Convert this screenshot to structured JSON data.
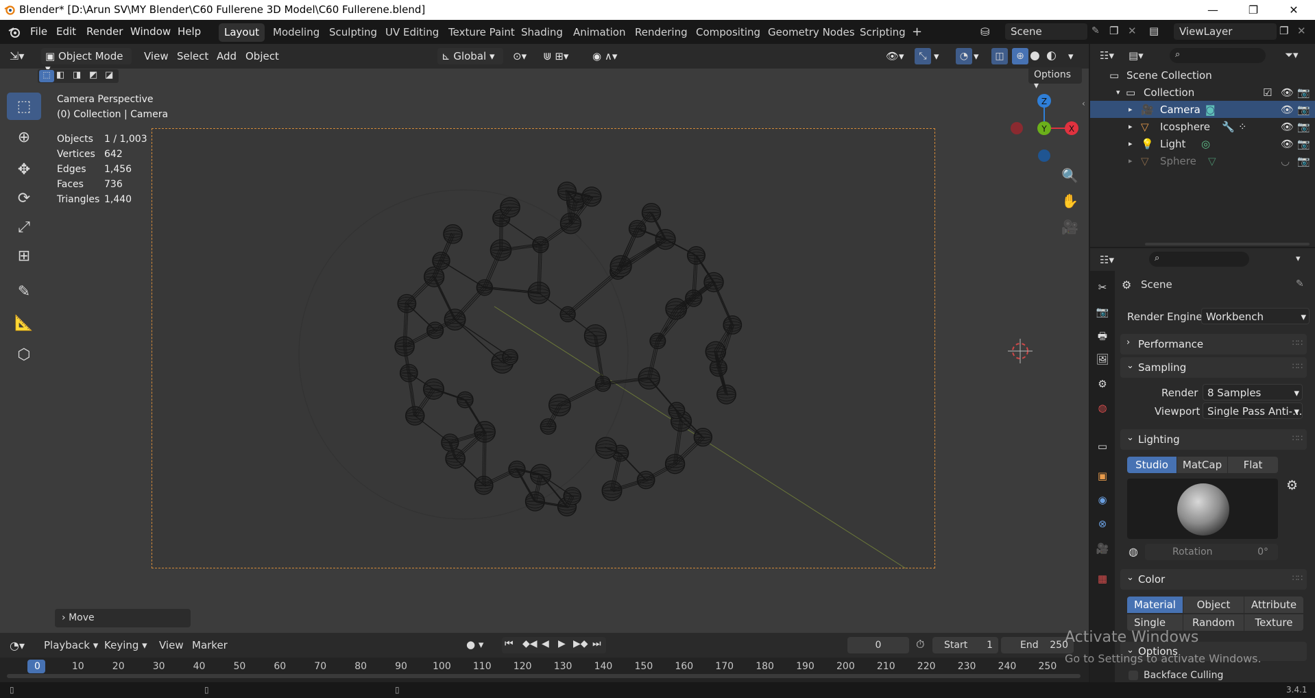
{
  "window": {
    "title": "Blender* [D:\\Arun SV\\MY Blender\\C60 Fullerene 3D Model\\C60 Fullerene.blend]",
    "minimize": "—",
    "maximize": "❐",
    "close": "✕"
  },
  "menu": {
    "items": [
      "File",
      "Edit",
      "Render",
      "Window",
      "Help"
    ]
  },
  "workspaces": {
    "tabs": [
      "Layout",
      "Modeling",
      "Sculpting",
      "UV Editing",
      "Texture Paint",
      "Shading",
      "Animation",
      "Rendering",
      "Compositing",
      "Geometry Nodes",
      "Scripting"
    ],
    "active": "Layout",
    "add": "+"
  },
  "scene": {
    "label": "Scene",
    "view_layer": "ViewLayer"
  },
  "viewport": {
    "mode": "Object Mode",
    "menus": [
      "View",
      "Select",
      "Add",
      "Object"
    ],
    "transform_orientation": "Global",
    "options_label": "Options",
    "camera_title": "Camera Perspective",
    "collection_path": "(0) Collection | Camera",
    "stats": [
      {
        "key": "Objects",
        "value": "1 / 1,003"
      },
      {
        "key": "Vertices",
        "value": "642"
      },
      {
        "key": "Edges",
        "value": "1,456"
      },
      {
        "key": "Faces",
        "value": "736"
      },
      {
        "key": "Triangles",
        "value": "1,440"
      }
    ],
    "last_operator": "Move",
    "gizmo": {
      "z": "Z",
      "y": "Y",
      "x": "X"
    }
  },
  "outliner": {
    "root": "Scene Collection",
    "collection": "Collection",
    "items": [
      {
        "name": "Camera",
        "selected": true,
        "dimmed": false
      },
      {
        "name": "Icosphere",
        "selected": false,
        "dimmed": false
      },
      {
        "name": "Light",
        "selected": false,
        "dimmed": false
      },
      {
        "name": "Sphere",
        "selected": false,
        "dimmed": true
      }
    ]
  },
  "properties": {
    "context": "Scene",
    "render_engine_label": "Render Engine",
    "render_engine": "Workbench",
    "panels": {
      "performance": "Performance",
      "sampling": "Sampling",
      "lighting": "Lighting",
      "color": "Color",
      "options": "Options"
    },
    "sampling": {
      "render_label": "Render",
      "render_value": "8 Samples",
      "viewport_label": "Viewport",
      "viewport_value": "Single Pass Anti-..."
    },
    "lighting": {
      "modes": [
        "Studio",
        "MatCap",
        "Flat"
      ],
      "active": "Studio",
      "rotation_label": "Rotation",
      "rotation_value": "0°"
    },
    "color": {
      "row1": [
        "Material",
        "Object",
        "Attribute"
      ],
      "row2": [
        "Single",
        "Random",
        "Texture"
      ],
      "active": "Material"
    },
    "backface_culling": "Backface Culling"
  },
  "timeline": {
    "menus": [
      "Playback",
      "Keying",
      "View",
      "Marker"
    ],
    "current_frame": "0",
    "start_label": "Start",
    "start": "1",
    "end_label": "End",
    "end": "250",
    "ticks": [
      "0",
      "10",
      "20",
      "30",
      "40",
      "50",
      "60",
      "70",
      "80",
      "90",
      "100",
      "110",
      "120",
      "130",
      "140",
      "150",
      "160",
      "170",
      "180",
      "190",
      "200",
      "210",
      "220",
      "230",
      "240",
      "250"
    ]
  },
  "watermark": {
    "line1": "Activate Windows",
    "line2": "Go to Settings to activate Windows."
  },
  "version": "3.4.1",
  "colors": {
    "accent": "#4772b3",
    "selection": "#33507a",
    "camera_frame": "#d58b3a",
    "gizmo_x": "#e0323f",
    "gizmo_y": "#6bb01a",
    "gizmo_z": "#2f7fd8"
  }
}
